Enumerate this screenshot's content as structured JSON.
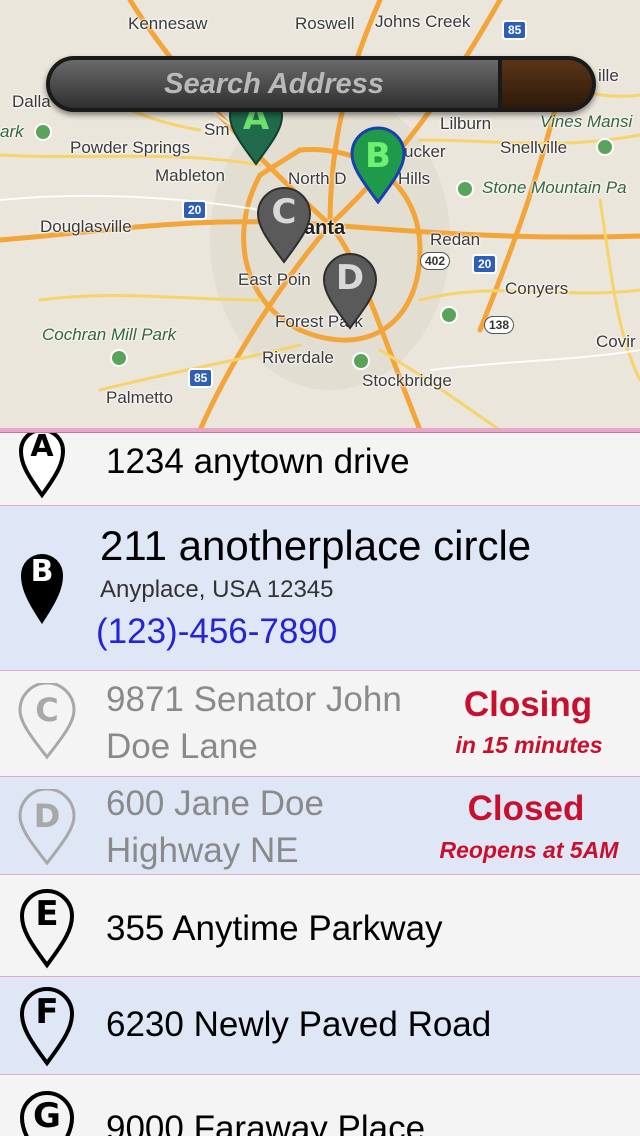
{
  "map": {
    "places": [
      "Kennesaw",
      "Roswell",
      "Johns Creek",
      "Dalla",
      "ark",
      "Powder Springs",
      "Sm",
      "Lilburn",
      "Vines Mansi",
      "Snellville",
      "Mableton",
      "North D",
      "ucker",
      "Hills",
      "Stone Mountain Pa",
      "Douglasville",
      "anta",
      "Redan",
      "East Poin",
      "Conyers",
      "Cochran Mill Park",
      "Forest Park",
      "Covir",
      "Riverdale",
      "Stockbridge",
      "Palmetto",
      "ille"
    ],
    "roads": [
      "85",
      "20",
      "402",
      "20",
      "138",
      "85"
    ],
    "pins": [
      "A",
      "B",
      "C",
      "D"
    ]
  },
  "search": {
    "placeholder": "Search Address"
  },
  "colors": {
    "pin_active": "#1e9a4a",
    "pin_a": "#1f6b4c",
    "pin_gray": "#5a5a5a",
    "status_red": "#c8102e",
    "phone_blue": "#2323d8",
    "divider_pink": "#e8a6c8"
  },
  "locations": [
    {
      "letter": "A",
      "address": "1234 anytown drive"
    },
    {
      "letter": "B",
      "address": "211 anotherplace circle",
      "city": "Anyplace, USA 12345",
      "phone": "(123)-456-7890"
    },
    {
      "letter": "C",
      "address_line1": "9871 Senator John",
      "address_line2": "Doe Lane",
      "status": "Closing",
      "status_detail": "in 15 minutes"
    },
    {
      "letter": "D",
      "address_line1": "600 Jane Doe",
      "address_line2": "Highway NE",
      "status": "Closed",
      "status_detail": "Reopens at 5AM"
    },
    {
      "letter": "E",
      "address": "355 Anytime Parkway"
    },
    {
      "letter": "F",
      "address": "6230 Newly Paved Road"
    },
    {
      "letter": "G",
      "address": "9000 Faraway Place"
    }
  ]
}
